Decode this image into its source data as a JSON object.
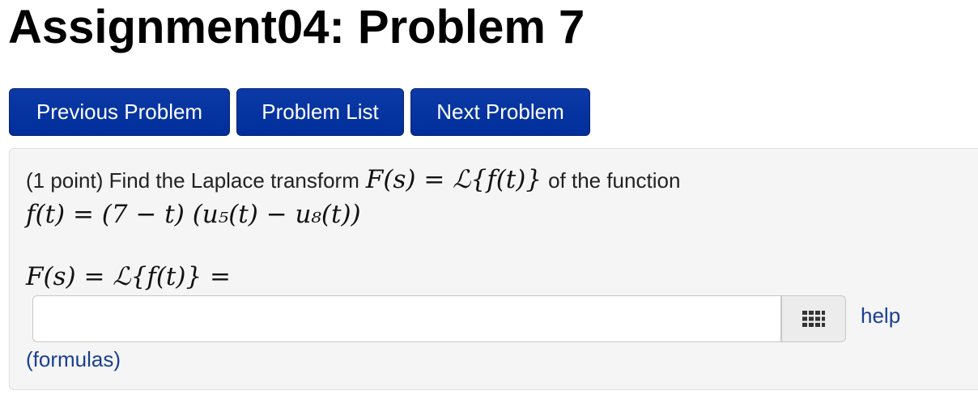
{
  "page": {
    "title": "Assignment04: Problem 7"
  },
  "nav": {
    "previous_label": "Previous Problem",
    "list_label": "Problem List",
    "next_label": "Next Problem"
  },
  "problem": {
    "intro_text": "(1 point) Find the Laplace transform",
    "transform_expr": "F(s) = ℒ{f(t)}",
    "intro_suffix": "of the function",
    "function_expr": "f(t) = (7 − t) (u₅(t) − u₈(t))",
    "answer_label": "F(s) = ℒ{f(t)} =",
    "answer_value": "",
    "palette_icon": "equation-palette-icon",
    "help_label": "help",
    "formulas_label": "(formulas)"
  },
  "colors": {
    "button_bg": "#002e9a",
    "panel_bg": "#f5f5f5",
    "link": "#1a3f8f"
  }
}
